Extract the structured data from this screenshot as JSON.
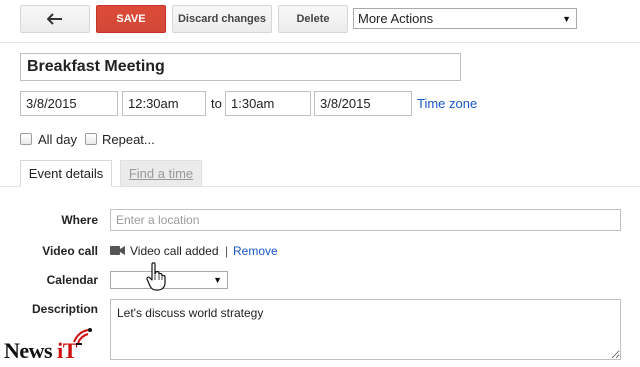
{
  "toolbar": {
    "back_icon": "back-arrow-icon",
    "save_label": "SAVE",
    "discard_label": "Discard changes",
    "delete_label": "Delete",
    "more_actions_label": "More Actions"
  },
  "event": {
    "title": "Breakfast Meeting",
    "start_date": "3/8/2015",
    "start_time": "12:30am",
    "to_label": "to",
    "end_time": "1:30am",
    "end_date": "3/8/2015",
    "time_zone_label": "Time zone",
    "all_day_label": "All day",
    "repeat_label": "Repeat..."
  },
  "tabs": [
    {
      "label": "Event details",
      "active": true
    },
    {
      "label": "Find a time",
      "active": false
    }
  ],
  "details": {
    "where_label": "Where",
    "where_placeholder": "Enter a location",
    "video_call_label": "Video call",
    "video_icon": "video-camera-icon",
    "video_status": "Video call added",
    "separator": "|",
    "remove_label": "Remove",
    "calendar_label": "Calendar",
    "calendar_value": "",
    "description_label": "Description",
    "description_value": "Let's discuss world strategy"
  },
  "watermark": {
    "text_main": "News",
    "text_accent": "iT"
  },
  "colors": {
    "save_button": "#d14836",
    "link": "#1a56c6"
  }
}
